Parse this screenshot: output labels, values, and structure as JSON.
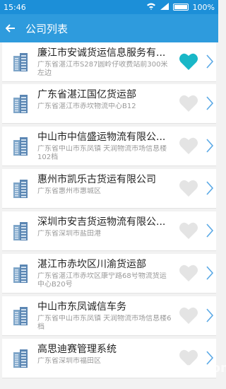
{
  "status_bar": {
    "time": "15:46",
    "battery": "100%",
    "battery_level": 1.0
  },
  "app_bar": {
    "back_icon": "back-arrow-icon",
    "title": "公司列表"
  },
  "companies": [
    {
      "name": "廉江市安诚货运信息服务有...",
      "address": "广东省湛江市S287圆岭仔收费站前300米左边",
      "favorite": true
    },
    {
      "name": "广东省湛江国亿货运部",
      "address": "广东省湛江市赤坎物流中心B12",
      "favorite": false
    },
    {
      "name": "中山市中信盛运物流有限公...",
      "address": "广东省中山市东凤镇 天润物流市场信息楼102档",
      "favorite": false
    },
    {
      "name": "惠州市凯乐古货运有限公司",
      "address": "广东省惠州市惠城区",
      "favorite": false
    },
    {
      "name": "深圳市安吉货运物流有限公...",
      "address": "广东省深圳市盐田港",
      "favorite": false
    },
    {
      "name": "湛江市赤坎区川渝货运部",
      "address": "广东省湛江市赤坎区康宁路68号物流货运中心B20号",
      "favorite": false
    },
    {
      "name": "中山市东凤诚信车务",
      "address": "广东省中山市东凤镇 天润物流市场信息楼6档",
      "favorite": false
    },
    {
      "name": "高思迪赛管理系统",
      "address": "广东省深圳市福田区",
      "favorite": false
    }
  ],
  "colors": {
    "status_bar": "#1c8fd8",
    "app_bar": "#2e9bdd",
    "heart_active": "#19b7c7",
    "heart_inactive": "#e4e4e4",
    "chevron": "#5aa9e6"
  },
  "watermark": "xfdown.com"
}
